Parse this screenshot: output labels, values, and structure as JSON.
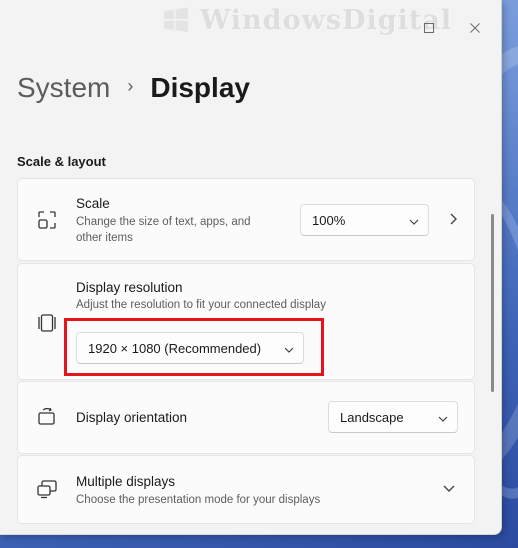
{
  "watermark": {
    "text": "WindowsDigital"
  },
  "breadcrumb": {
    "parent": "System",
    "separator": "›",
    "current": "Display"
  },
  "section": {
    "title": "Scale & layout"
  },
  "scale": {
    "title": "Scale",
    "description": "Change the size of text, apps, and other items",
    "value": "100%"
  },
  "resolution": {
    "title": "Display resolution",
    "description": "Adjust the resolution to fit your connected display",
    "value": "1920 × 1080 (Recommended)"
  },
  "orientation": {
    "title": "Display orientation",
    "value": "Landscape"
  },
  "multiple": {
    "title": "Multiple displays",
    "description": "Choose the presentation mode for your displays"
  },
  "colors": {
    "highlight": "#e5141b",
    "wallpaper": "#4a6fc0"
  },
  "icons": [
    "maximize-icon",
    "close-icon",
    "scale-icon",
    "resolution-icon",
    "orientation-icon",
    "multiple-displays-icon",
    "chevron-down-icon",
    "chevron-right-icon"
  ]
}
